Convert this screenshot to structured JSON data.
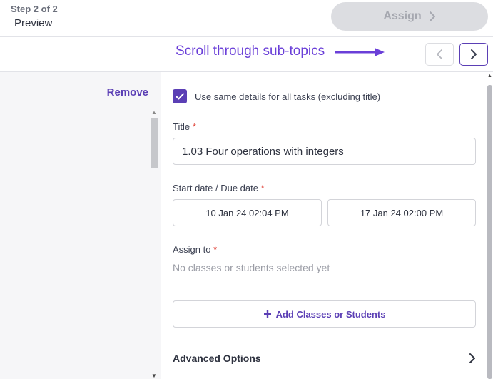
{
  "header": {
    "step": "Step 2 of 2",
    "title": "Preview",
    "assign_label": "Assign"
  },
  "subtopics": {
    "hint": "Scroll through sub-topics",
    "hint_color": "#6a3fd8"
  },
  "left_panel": {
    "remove_label": "Remove"
  },
  "form": {
    "same_details_label": "Use same details for all tasks (excluding title)",
    "same_details_checked": true,
    "title_label": "Title",
    "title_value": "1.03 Four operations with integers",
    "dates_label": "Start date / Due date",
    "start_date": "10 Jan 24 02:04 PM",
    "due_date": "17 Jan 24 02:00 PM",
    "assign_to_label": "Assign to",
    "assign_to_empty": "No classes or students selected yet",
    "add_button_label": "Add Classes or Students",
    "advanced_label": "Advanced Options",
    "required_mark": "*"
  },
  "colors": {
    "accent": "#5b3fb5",
    "required": "#e0443a",
    "disabled_button": "#dcdde1"
  }
}
